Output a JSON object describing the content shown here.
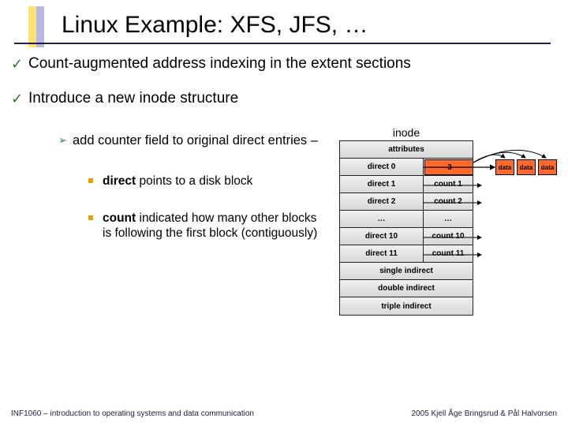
{
  "title": "Linux Example: XFS, JFS, …",
  "bullets": {
    "b1": "Count-augmented address indexing in the extent sections",
    "b2": "Introduce a new inode structure",
    "sub1": "add counter field to original direct entries –",
    "subsub1_pre": "direct",
    "subsub1_post": " points to a disk block",
    "subsub2_pre": "count",
    "subsub2_post": " indicated how many other blocks is following the first block (contiguously)"
  },
  "diagram": {
    "title": "inode",
    "rows": {
      "attributes": "attributes",
      "direct0": "direct 0",
      "three": "3",
      "direct1": "direct 1",
      "count1": "count 1",
      "direct2": "direct 2",
      "count2": "count 2",
      "dotsL": "…",
      "dotsR": "…",
      "direct10": "direct 10",
      "count10": "count 10",
      "direct11": "direct 11",
      "count11": "count 11",
      "single": "single indirect",
      "double": "double indirect",
      "triple": "triple indirect"
    },
    "data_label": "data"
  },
  "footer": {
    "left": "INF1060 – introduction to operating systems and data communication",
    "right": "2005 Kjell Åge Bringsrud & Pål Halvorsen"
  }
}
